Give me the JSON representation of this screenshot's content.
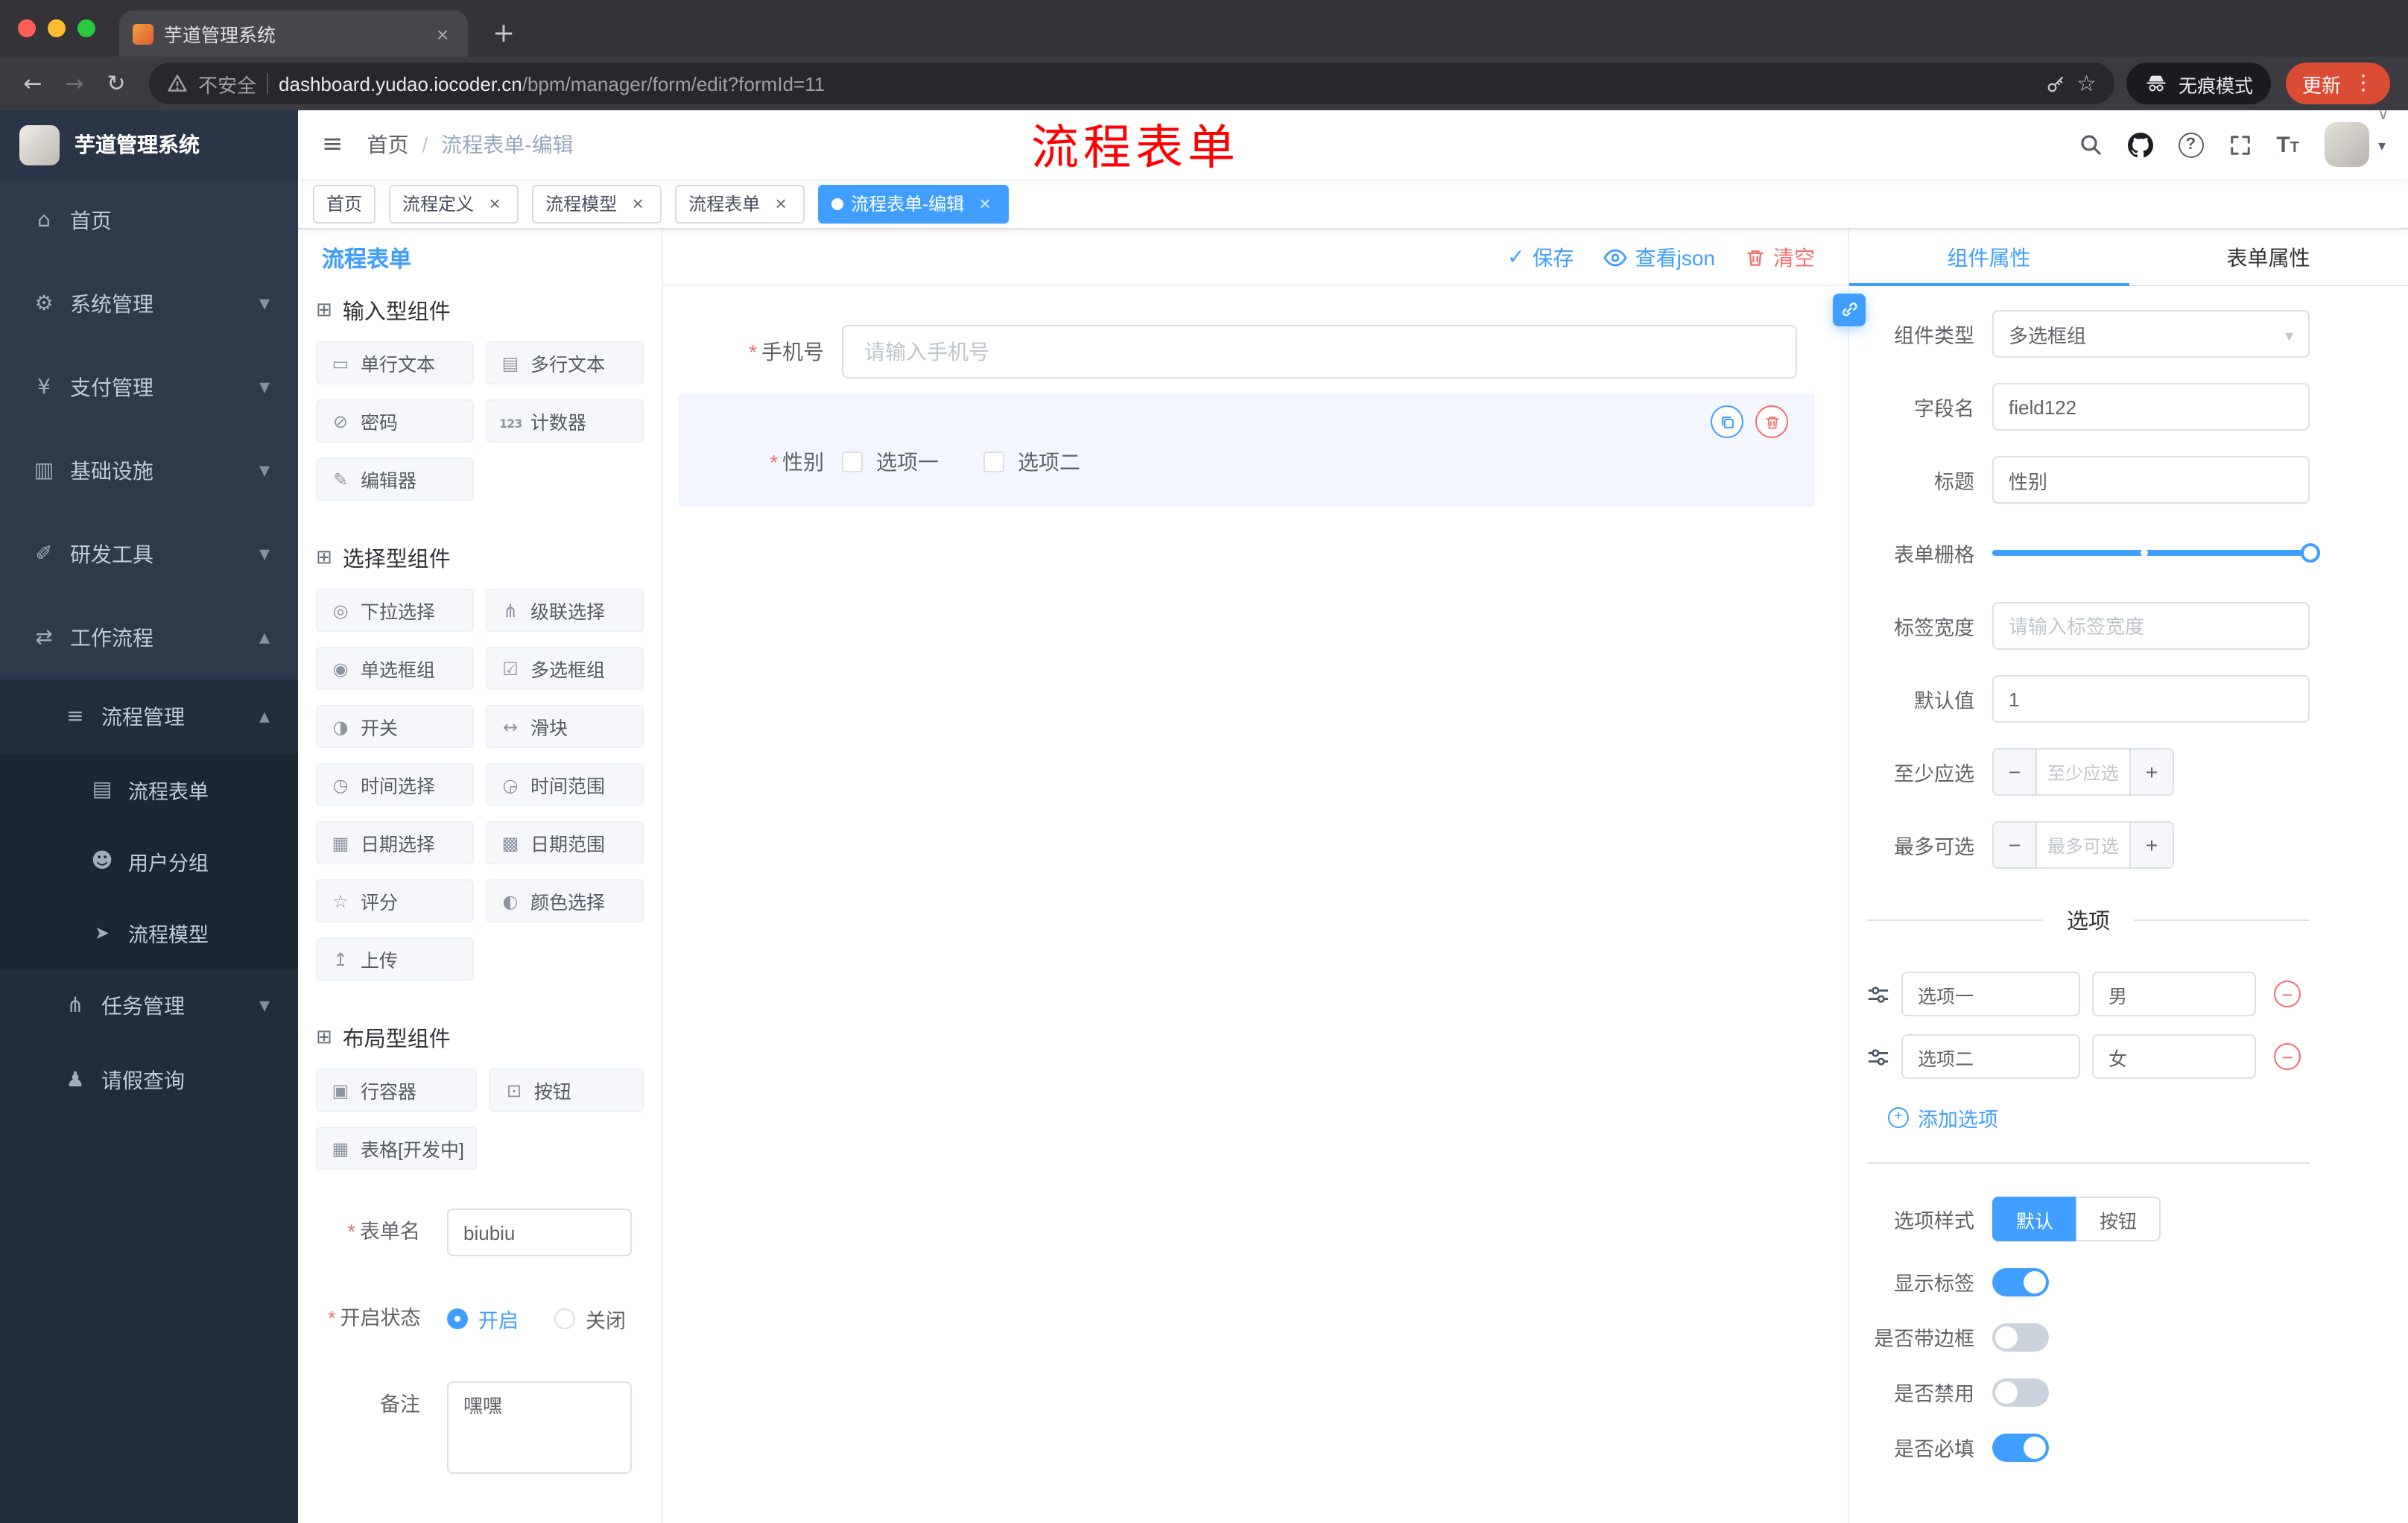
{
  "browser": {
    "tab_title": "芋道管理系统",
    "security_label": "不安全",
    "url_domain": "dashboard.yudao.iocoder.cn",
    "url_path": "/bpm/manager/form/edit?formId=11",
    "incognito_label": "无痕模式",
    "update_label": "更新",
    "nav_icons": [
      "back-icon",
      "forward-icon",
      "reload-icon",
      "warning-icon",
      "key-icon",
      "star-icon",
      "more-dots-icon"
    ]
  },
  "sidebar": {
    "logo_title": "芋道管理系统",
    "items": [
      {
        "label": "首页",
        "icon": "home-icon",
        "level": 1
      },
      {
        "label": "系统管理",
        "icon": "system-icon",
        "level": 1,
        "arrow": "down"
      },
      {
        "label": "支付管理",
        "icon": "payment-icon",
        "level": 1,
        "arrow": "down"
      },
      {
        "label": "基础设施",
        "icon": "infrastructure-icon",
        "level": 1,
        "arrow": "down"
      },
      {
        "label": "研发工具",
        "icon": "devtools-icon",
        "level": 1,
        "arrow": "down"
      },
      {
        "label": "工作流程",
        "icon": "workflow-icon",
        "level": 1,
        "arrow": "up"
      },
      {
        "label": "流程管理",
        "icon": "process-manage-icon",
        "level": 2,
        "arrow": "up"
      },
      {
        "label": "流程表单",
        "icon": "process-form-icon",
        "level": 3
      },
      {
        "label": "用户分组",
        "icon": "user-group-icon",
        "level": 3
      },
      {
        "label": "流程模型",
        "icon": "process-model-icon",
        "level": 3
      },
      {
        "label": "任务管理",
        "icon": "task-manage-icon",
        "level": 2,
        "arrow": "down"
      },
      {
        "label": "请假查询",
        "icon": "leave-query-icon",
        "level": 2
      }
    ]
  },
  "header": {
    "breadcrumb_home": "首页",
    "breadcrumb_current": "流程表单-编辑",
    "watermark": "流程表单",
    "right_icons": [
      "search-icon",
      "github-icon",
      "help-icon",
      "fullscreen-icon",
      "font-size-icon",
      "avatar",
      "caret-down-icon"
    ]
  },
  "tags": [
    {
      "label": "首页",
      "active": false,
      "closable": false
    },
    {
      "label": "流程定义",
      "active": false,
      "closable": true
    },
    {
      "label": "流程模型",
      "active": false,
      "closable": true
    },
    {
      "label": "流程表单",
      "active": false,
      "closable": true
    },
    {
      "label": "流程表单-编辑",
      "active": true,
      "closable": true
    }
  ],
  "palette": {
    "title": "流程表单",
    "groups": [
      {
        "title": "输入型组件",
        "items": [
          {
            "label": "单行文本",
            "icon": "single-line-text-icon"
          },
          {
            "label": "多行文本",
            "icon": "multi-line-text-icon"
          },
          {
            "label": "密码",
            "icon": "password-icon"
          },
          {
            "label": "计数器",
            "icon": "counter-icon"
          },
          {
            "label": "编辑器",
            "icon": "editor-icon"
          }
        ]
      },
      {
        "title": "选择型组件",
        "items": [
          {
            "label": "下拉选择",
            "icon": "dropdown-icon"
          },
          {
            "label": "级联选择",
            "icon": "cascader-icon"
          },
          {
            "label": "单选框组",
            "icon": "radio-group-icon"
          },
          {
            "label": "多选框组",
            "icon": "checkbox-group-icon"
          },
          {
            "label": "开关",
            "icon": "switch-icon"
          },
          {
            "label": "滑块",
            "icon": "slider-icon"
          },
          {
            "label": "时间选择",
            "icon": "time-picker-icon"
          },
          {
            "label": "时间范围",
            "icon": "time-range-icon"
          },
          {
            "label": "日期选择",
            "icon": "date-picker-icon"
          },
          {
            "label": "日期范围",
            "icon": "date-range-icon"
          },
          {
            "label": "评分",
            "icon": "rate-icon"
          },
          {
            "label": "颜色选择",
            "icon": "color-picker-icon"
          },
          {
            "label": "上传",
            "icon": "upload-icon"
          }
        ]
      },
      {
        "title": "布局型组件",
        "items": [
          {
            "label": "行容器",
            "icon": "row-container-icon"
          },
          {
            "label": "按钮",
            "icon": "button-icon"
          },
          {
            "label": "表格[开发中]",
            "icon": "table-icon"
          }
        ]
      }
    ],
    "form": {
      "name": {
        "label": "表单名",
        "required": true,
        "value": "biubiu"
      },
      "status": {
        "label": "开启状态",
        "required": true,
        "options": [
          "开启",
          "关闭"
        ],
        "selected": "开启"
      },
      "remark": {
        "label": "备注",
        "value": "嘿嘿"
      }
    }
  },
  "canvas": {
    "toolbar": {
      "save": "保存",
      "view_json": "查看json",
      "clear": "清空"
    },
    "fields": {
      "phone": {
        "label": "手机号",
        "required": true,
        "placeholder": "请输入手机号"
      },
      "gender": {
        "label": "性别",
        "required": true,
        "options": [
          "选项一",
          "选项二"
        ],
        "checked": [
          false,
          false
        ],
        "selected_widget": true
      }
    }
  },
  "props": {
    "tabs": {
      "component": "组件属性",
      "form": "表单属性",
      "active": "组件属性"
    },
    "component_type": {
      "label": "组件类型",
      "value": "多选框组"
    },
    "field_name": {
      "label": "字段名",
      "value": "field122"
    },
    "title": {
      "label": "标题",
      "value": "性别"
    },
    "form_grid": {
      "label": "表单栅格"
    },
    "label_width": {
      "label": "标签宽度",
      "placeholder": "请输入标签宽度"
    },
    "default_value": {
      "label": "默认值",
      "value": "1"
    },
    "min_select": {
      "label": "至少应选",
      "placeholder": "至少应选"
    },
    "max_select": {
      "label": "最多可选",
      "placeholder": "最多可选"
    },
    "options": {
      "divider_title": "选项",
      "rows": [
        {
          "label": "选项一",
          "value": "男"
        },
        {
          "label": "选项二",
          "value": "女"
        }
      ],
      "add_label": "添加选项"
    },
    "option_style": {
      "label": "选项样式",
      "choices": [
        "默认",
        "按钮"
      ],
      "selected": "默认"
    },
    "switches": [
      {
        "label": "显示标签",
        "on": true
      },
      {
        "label": "是否带边框",
        "on": false
      },
      {
        "label": "是否禁用",
        "on": false
      },
      {
        "label": "是否必填",
        "on": true
      }
    ]
  },
  "colors": {
    "accent": "#409EFF",
    "danger": "#F56C6C",
    "watermark_red": "#FF0000",
    "active_tag_bg": "#409EFF",
    "update_pill": "#DA4C34",
    "sidebar_bg": "#2D3A4B"
  }
}
